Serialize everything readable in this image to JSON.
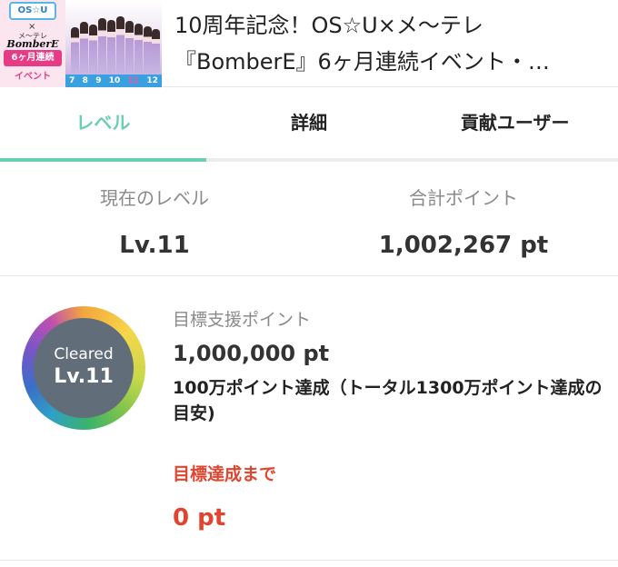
{
  "header": {
    "banner": {
      "logo_top": "OS☆U",
      "x": "×",
      "mid": "メ〜テレ",
      "bomber": "BomberE",
      "badge": "6ヶ月連続",
      "event": "イベント",
      "numbers": [
        "7",
        "8",
        "9",
        "10",
        "11",
        "12"
      ]
    },
    "title_line1": "10周年記念！OS☆U×メ〜テレ",
    "title_line2": "『BomberE』6ヶ月連続イベント・…"
  },
  "tabs": [
    {
      "label": "レベル",
      "active": true
    },
    {
      "label": "詳細",
      "active": false
    },
    {
      "label": "貢献ユーザー",
      "active": false
    }
  ],
  "stats": {
    "current_level_label": "現在のレベル",
    "current_level_value": "Lv.11",
    "total_points_label": "合計ポイント",
    "total_points_value": "1,002,267 pt"
  },
  "target": {
    "badge_status": "Cleared",
    "badge_level": "Lv.11",
    "label": "目標支援ポイント",
    "value": "1,000,000 pt",
    "description": "100万ポイント達成（トータル1300万ポイント達成の目安)",
    "remaining_label": "目標達成まで",
    "remaining_value": "0 pt"
  },
  "colors": {
    "accent": "#6ccfb4",
    "alert": "#e0452f",
    "badge_bg": "#626d7a"
  }
}
